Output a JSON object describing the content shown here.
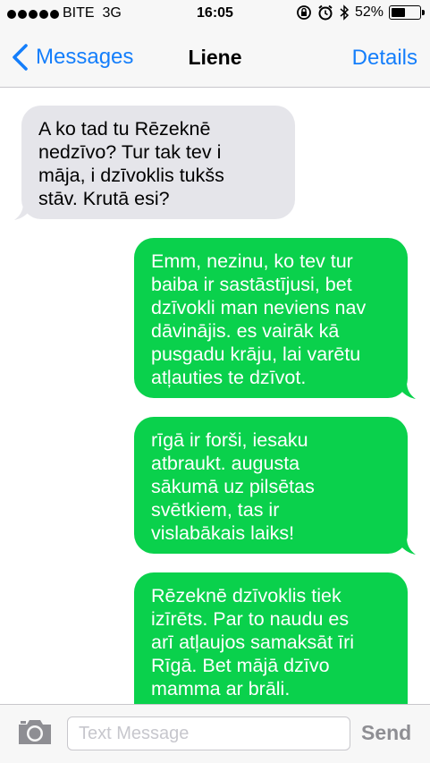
{
  "status_bar": {
    "carrier": "BITE",
    "network": "3G",
    "time": "16:05",
    "battery": "52%",
    "battery_level": 0.52,
    "signal_bars": 5,
    "icons": [
      "rotation-lock-icon",
      "alarm-icon",
      "bluetooth-icon",
      "battery-icon"
    ]
  },
  "nav": {
    "back_label": "Messages",
    "title": "Liene",
    "details_label": "Details"
  },
  "colors": {
    "accent": "#147efb",
    "sent_bubble": "#0ad14c",
    "received_bubble": "#e5e5ea"
  },
  "messages": [
    {
      "direction": "received",
      "text": "A ko tad tu Rēzeknē\nnedzīvo? Tur tak tev i\nmāja, i dzīvoklis tukšs\nstāv. Krutā esi?"
    },
    {
      "direction": "sent",
      "text": "Emm, nezinu, ko tev tur\nbaiba ir sastāstījusi, bet\ndzīvokli man neviens nav\ndāvinājis. es vairāk kā\npusgadu krāju, lai varētu\natļauties te dzīvot."
    },
    {
      "direction": "sent",
      "text": "rīgā ir forši, iesaku\natbraukt. augusta\nsākumā uz pilsētas\nsvētkiem, tas ir\nvislabākais laiks!"
    },
    {
      "direction": "sent",
      "text": "Rēzeknē dzīvoklis tiek\nizīrēts. Par to naudu es\narī atļaujos samaksāt īri\nRīgā. Bet mājā dzīvo\nmamma ar brāli."
    }
  ],
  "composer": {
    "placeholder": "Text Message",
    "value": "",
    "send_label": "Send",
    "camera_icon": "camera-icon"
  }
}
